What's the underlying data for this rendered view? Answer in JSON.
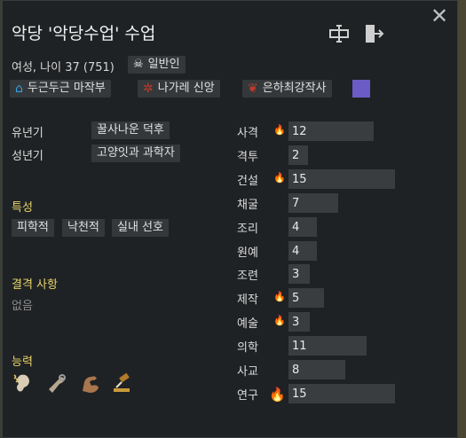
{
  "title": "악당 '악당수업' 수업",
  "close_icon": "close-icon",
  "header_icons": [
    "rename-icon",
    "exit-icon"
  ],
  "subtitle": "여성, 나이 37 (751)",
  "faction_badge": {
    "icon": "skull-icon",
    "label": "일반인"
  },
  "tags": [
    {
      "icon": "house-icon",
      "label": "두근두근 마작부",
      "icon_color": "#3aa0e0"
    },
    {
      "icon": "ideology-icon",
      "label": "나가레 신앙",
      "icon_color": "#c0392b"
    },
    {
      "icon": "faction-icon",
      "label": "은하최강작사",
      "icon_color": "#c0392b"
    }
  ],
  "swatch_color": "#6b5bc4",
  "backstory": [
    {
      "label": "유년기",
      "value": "꿀사나운 덕후"
    },
    {
      "label": "성년기",
      "value": "고양잇과 과학자"
    }
  ],
  "traits": {
    "heading": "특성",
    "items": [
      "피학적",
      "낙천적",
      "실내 선호"
    ]
  },
  "incapable": {
    "heading": "결격 사항",
    "value": "없음"
  },
  "abilities": {
    "heading": "능력",
    "icons": [
      "hearing-icon",
      "manipulation-icon",
      "strength-icon",
      "gavel-icon"
    ]
  },
  "skills": [
    {
      "name": "사격",
      "value": "12",
      "level": 12,
      "passion": "minor"
    },
    {
      "name": "격투",
      "value": "2",
      "level": 2,
      "passion": "none"
    },
    {
      "name": "건설",
      "value": "15",
      "level": 15,
      "passion": "minor"
    },
    {
      "name": "채굴",
      "value": "7",
      "level": 7,
      "passion": "none"
    },
    {
      "name": "조리",
      "value": "4",
      "level": 4,
      "passion": "none"
    },
    {
      "name": "원예",
      "value": "4",
      "level": 4,
      "passion": "none"
    },
    {
      "name": "조련",
      "value": "3",
      "level": 3,
      "passion": "none"
    },
    {
      "name": "제작",
      "value": "5",
      "level": 5,
      "passion": "minor"
    },
    {
      "name": "예술",
      "value": "3",
      "level": 3,
      "passion": "minor"
    },
    {
      "name": "의학",
      "value": "11",
      "level": 11,
      "passion": "none"
    },
    {
      "name": "사교",
      "value": "8",
      "level": 8,
      "passion": "none"
    },
    {
      "name": "연구",
      "value": "15",
      "level": 15,
      "passion": "major"
    }
  ],
  "skill_max": 20
}
